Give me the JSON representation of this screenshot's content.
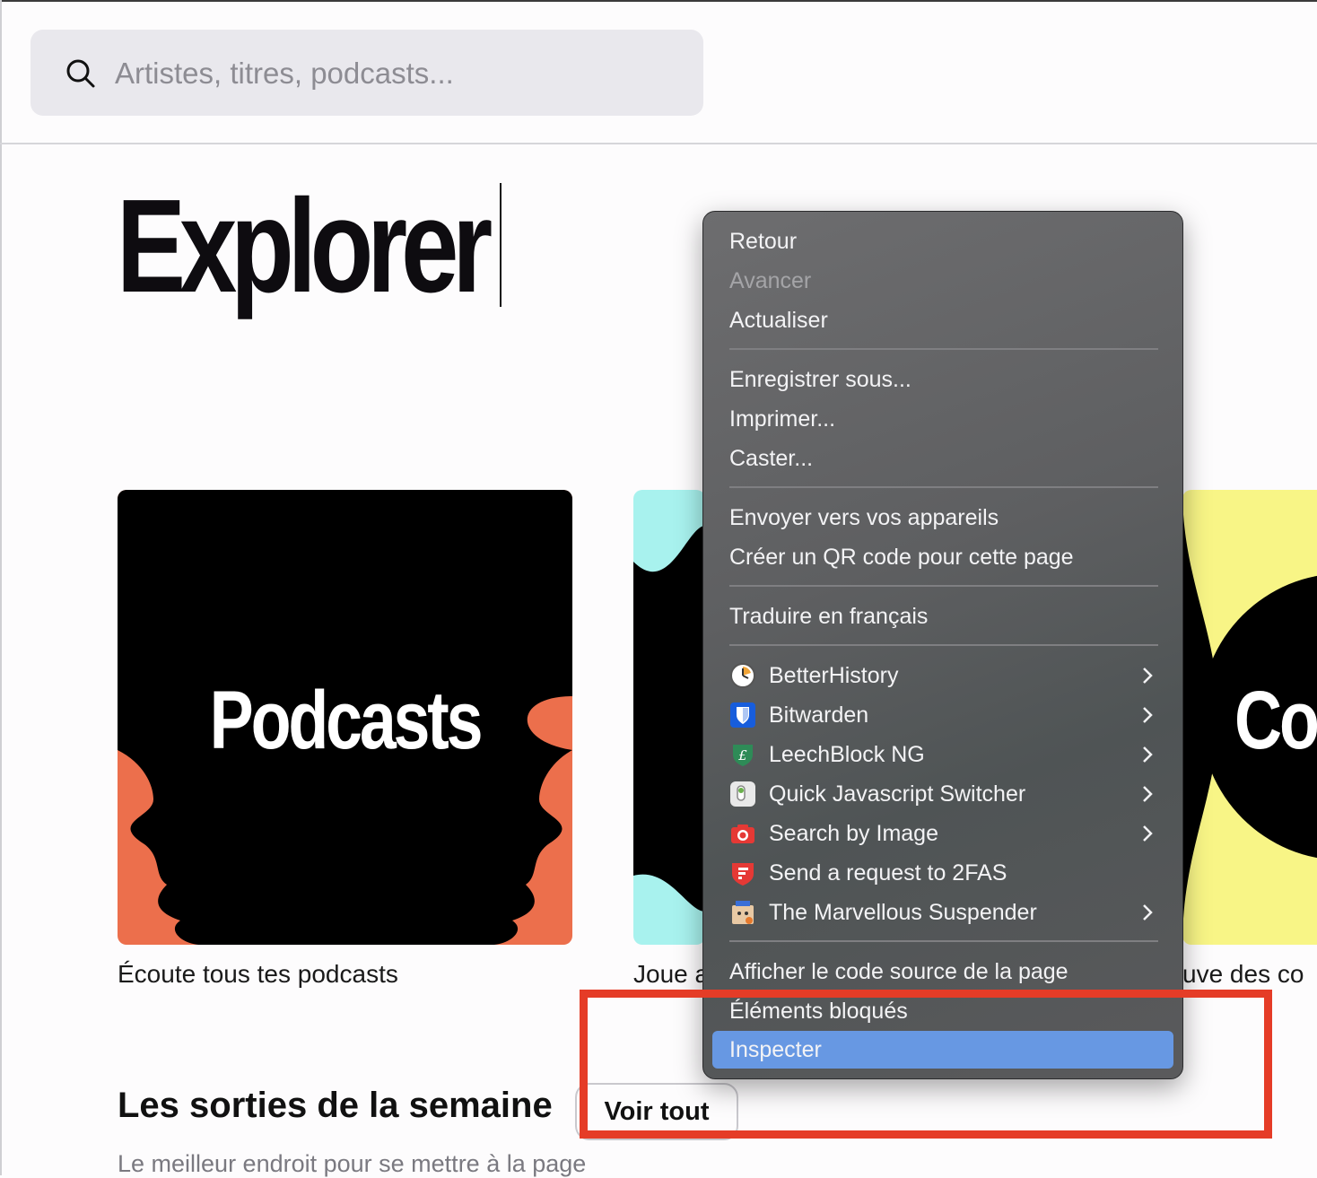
{
  "search": {
    "placeholder": "Artistes, titres, podcasts..."
  },
  "page": {
    "title": "Explorer"
  },
  "cards": [
    {
      "label": "Podcasts",
      "caption": "Écoute tous tes podcasts",
      "bg": "#ec6f4c"
    },
    {
      "label": "",
      "caption": "Joue a",
      "bg": "#a8f2ee"
    },
    {
      "label": "Co",
      "caption": "uve des co",
      "bg": "#f8f586"
    }
  ],
  "section": {
    "title": "Les sorties de la semaine",
    "see_all": "Voir tout",
    "subtitle": "Le meilleur endroit pour se mettre à la page"
  },
  "context_menu": {
    "back": "Retour",
    "forward": "Avancer",
    "reload": "Actualiser",
    "save_as": "Enregistrer sous...",
    "print": "Imprimer...",
    "cast": "Caster...",
    "send_to_devices": "Envoyer vers vos appareils",
    "create_qr": "Créer un QR code pour cette page",
    "translate": "Traduire en français",
    "extensions": [
      {
        "label": "BetterHistory",
        "icon": "clock-icon",
        "submenu": true
      },
      {
        "label": "Bitwarden",
        "icon": "shield-icon",
        "submenu": true
      },
      {
        "label": "LeechBlock NG",
        "icon": "leech-shield-icon",
        "submenu": true
      },
      {
        "label": "Quick Javascript Switcher",
        "icon": "toggle-icon",
        "submenu": true
      },
      {
        "label": "Search by Image",
        "icon": "camera-icon",
        "submenu": true
      },
      {
        "label": "Send a request to 2FAS",
        "icon": "twofas-icon",
        "submenu": false
      },
      {
        "label": "The Marvellous Suspender",
        "icon": "suspender-icon",
        "submenu": true
      }
    ],
    "view_source": "Afficher le code source de la page",
    "blocked_elements": "Éléments bloqués",
    "inspect": "Inspecter"
  },
  "colors": {
    "menu_selected": "#6798e3",
    "highlight": "#e53c27",
    "search_bg": "#e9e8ed"
  }
}
